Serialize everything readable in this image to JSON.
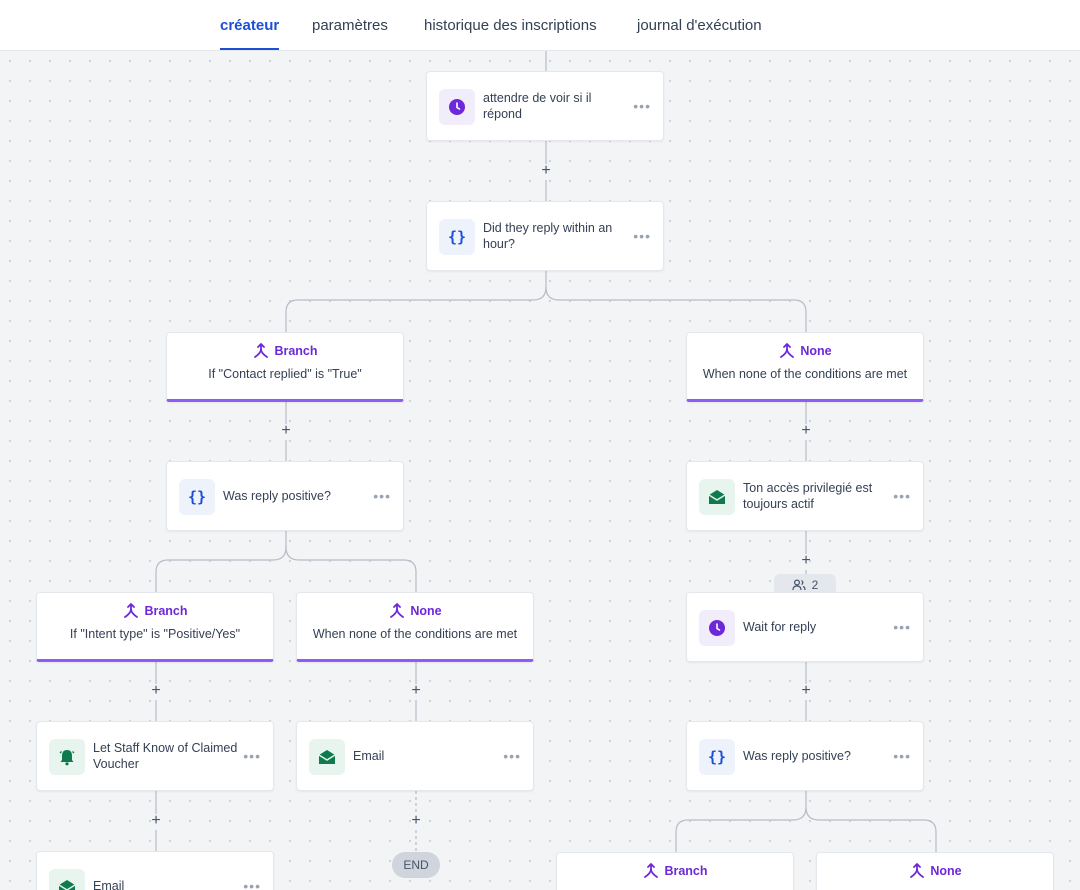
{
  "tabs": [
    {
      "label": "créateur",
      "active": true
    },
    {
      "label": "paramètres",
      "active": false
    },
    {
      "label": "historique des inscriptions",
      "active": false
    },
    {
      "label": "journal d'exécution",
      "active": false
    }
  ],
  "colors": {
    "accent_tab": "#1d4ed8",
    "branch_purple": "#6d28d9",
    "branch_border": "#8b5cf6",
    "email_green": "#0f7a4e",
    "condition_blue": "#1d4ed8",
    "wait_purple": "#6d28d9"
  },
  "workflow": {
    "wait_reply_check": {
      "label": "attendre de voir si il répond",
      "icon": "clock-icon"
    },
    "replied_within_hour": {
      "label": "Did they reply within an hour?",
      "icon": "braces-icon"
    },
    "branch_contact_replied": {
      "title": "Branch",
      "desc": "If \"Contact replied\" is \"True\""
    },
    "none_top": {
      "title": "None",
      "desc": "When none of the conditions are met"
    },
    "was_reply_positive_left": {
      "label": "Was reply positive?",
      "icon": "braces-icon"
    },
    "privileged_access_email": {
      "label": "Ton accès privilegié est toujours actif",
      "icon": "email-icon"
    },
    "enrolled_count": "2",
    "wait_for_reply": {
      "label": "Wait for reply",
      "icon": "clock-icon"
    },
    "branch_intent_positive": {
      "title": "Branch",
      "desc": "If \"Intent type\" is \"Positive/Yes\""
    },
    "none_mid": {
      "title": "None",
      "desc": "When none of the conditions are met"
    },
    "notify_staff": {
      "label": "Let Staff Know of Claimed Voucher",
      "icon": "bell-icon"
    },
    "email_none": {
      "label": "Email",
      "icon": "email-icon"
    },
    "end_label": "END",
    "email_bottom": {
      "label": "Email",
      "icon": "email-icon"
    },
    "was_reply_positive_right": {
      "label": "Was reply positive?",
      "icon": "braces-icon"
    },
    "branch_bottom": {
      "title": "Branch"
    },
    "none_bottom": {
      "title": "None"
    }
  }
}
